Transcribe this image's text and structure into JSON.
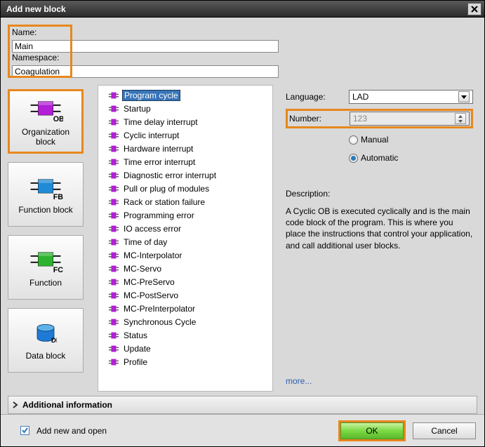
{
  "window": {
    "title": "Add new block"
  },
  "fields": {
    "name_label": "Name:",
    "name_value": "Main",
    "namespace_label": "Namespace:",
    "namespace_value": "Coagulation"
  },
  "block_types": [
    {
      "key": "ob",
      "label": "Organization block",
      "tag": "OB",
      "color": "#b21fd6",
      "selected": true
    },
    {
      "key": "fb",
      "label": "Function block",
      "tag": "FB",
      "color": "#1f8ad6",
      "selected": false
    },
    {
      "key": "fc",
      "label": "Function",
      "tag": "FC",
      "color": "#2db22f",
      "selected": false
    },
    {
      "key": "db",
      "label": "Data block",
      "tag": "DB",
      "color": "#1f7ad6",
      "selected": false,
      "shape": "cylinder"
    }
  ],
  "ob_list": [
    "Program cycle",
    "Startup",
    "Time delay interrupt",
    "Cyclic interrupt",
    "Hardware interrupt",
    "Time error interrupt",
    "Diagnostic error interrupt",
    "Pull or plug of modules",
    "Rack or station failure",
    "Programming error",
    "IO access error",
    "Time of day",
    "MC-Interpolator",
    "MC-Servo",
    "MC-PreServo",
    "MC-PostServo",
    "MC-PreInterpolator",
    "Synchronous Cycle",
    "Status",
    "Update",
    "Profile"
  ],
  "ob_selected_index": 0,
  "right": {
    "language_label": "Language:",
    "language_value": "LAD",
    "number_label": "Number:",
    "number_value": "123",
    "manual_label": "Manual",
    "automatic_label": "Automatic",
    "mode": "automatic",
    "description_label": "Description:",
    "description_text": "A Cyclic OB is executed cyclically and is the main code block of the program. This is where you place the instructions that control your application, and call additional user blocks.",
    "more_label": "more..."
  },
  "addl_info_label": "Additional information",
  "footer": {
    "add_open_label": "Add new and open",
    "add_open_checked": true,
    "ok_label": "OK",
    "cancel_label": "Cancel"
  }
}
